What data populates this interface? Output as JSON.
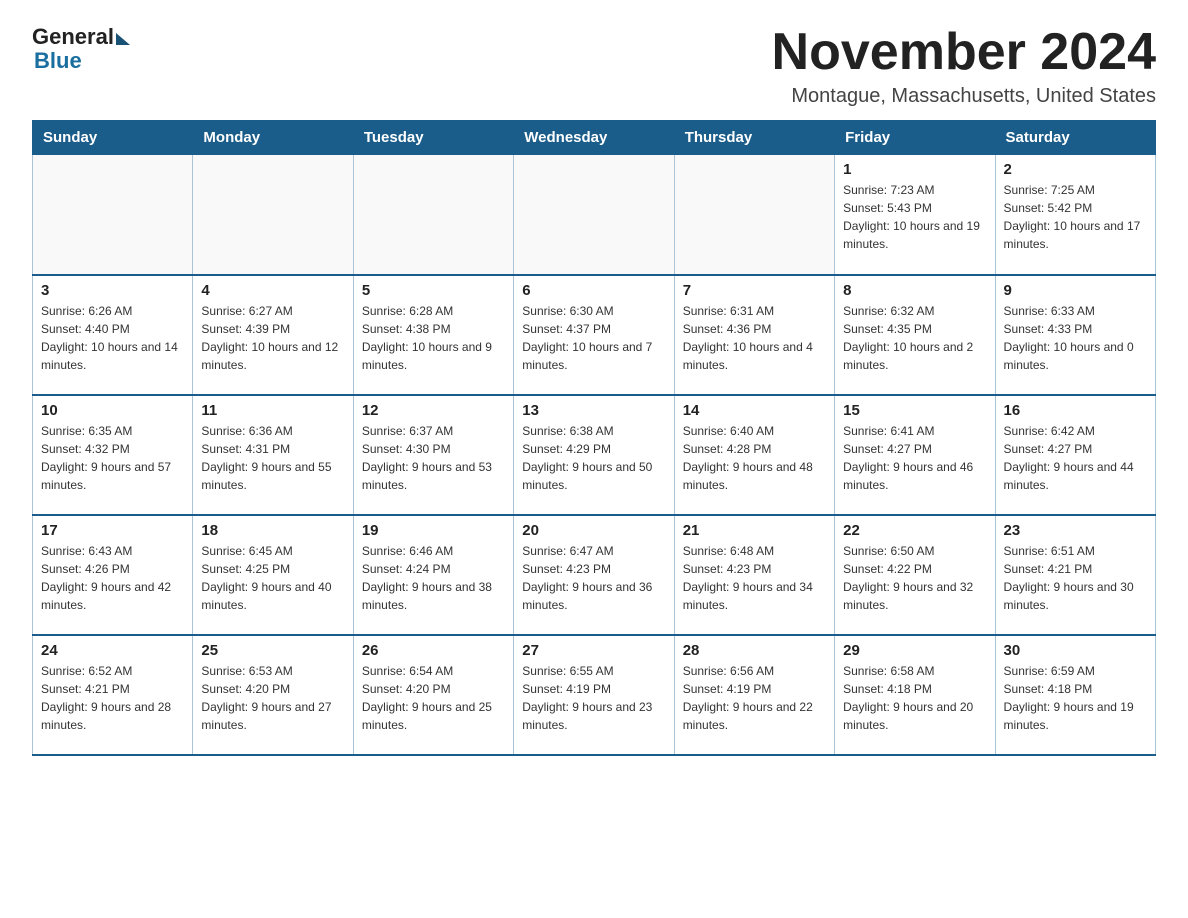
{
  "logo": {
    "general": "General",
    "blue": "Blue"
  },
  "header": {
    "month": "November 2024",
    "location": "Montague, Massachusetts, United States"
  },
  "days_of_week": [
    "Sunday",
    "Monday",
    "Tuesday",
    "Wednesday",
    "Thursday",
    "Friday",
    "Saturday"
  ],
  "weeks": [
    [
      {
        "day": "",
        "info": ""
      },
      {
        "day": "",
        "info": ""
      },
      {
        "day": "",
        "info": ""
      },
      {
        "day": "",
        "info": ""
      },
      {
        "day": "",
        "info": ""
      },
      {
        "day": "1",
        "info": "Sunrise: 7:23 AM\nSunset: 5:43 PM\nDaylight: 10 hours and 19 minutes."
      },
      {
        "day": "2",
        "info": "Sunrise: 7:25 AM\nSunset: 5:42 PM\nDaylight: 10 hours and 17 minutes."
      }
    ],
    [
      {
        "day": "3",
        "info": "Sunrise: 6:26 AM\nSunset: 4:40 PM\nDaylight: 10 hours and 14 minutes."
      },
      {
        "day": "4",
        "info": "Sunrise: 6:27 AM\nSunset: 4:39 PM\nDaylight: 10 hours and 12 minutes."
      },
      {
        "day": "5",
        "info": "Sunrise: 6:28 AM\nSunset: 4:38 PM\nDaylight: 10 hours and 9 minutes."
      },
      {
        "day": "6",
        "info": "Sunrise: 6:30 AM\nSunset: 4:37 PM\nDaylight: 10 hours and 7 minutes."
      },
      {
        "day": "7",
        "info": "Sunrise: 6:31 AM\nSunset: 4:36 PM\nDaylight: 10 hours and 4 minutes."
      },
      {
        "day": "8",
        "info": "Sunrise: 6:32 AM\nSunset: 4:35 PM\nDaylight: 10 hours and 2 minutes."
      },
      {
        "day": "9",
        "info": "Sunrise: 6:33 AM\nSunset: 4:33 PM\nDaylight: 10 hours and 0 minutes."
      }
    ],
    [
      {
        "day": "10",
        "info": "Sunrise: 6:35 AM\nSunset: 4:32 PM\nDaylight: 9 hours and 57 minutes."
      },
      {
        "day": "11",
        "info": "Sunrise: 6:36 AM\nSunset: 4:31 PM\nDaylight: 9 hours and 55 minutes."
      },
      {
        "day": "12",
        "info": "Sunrise: 6:37 AM\nSunset: 4:30 PM\nDaylight: 9 hours and 53 minutes."
      },
      {
        "day": "13",
        "info": "Sunrise: 6:38 AM\nSunset: 4:29 PM\nDaylight: 9 hours and 50 minutes."
      },
      {
        "day": "14",
        "info": "Sunrise: 6:40 AM\nSunset: 4:28 PM\nDaylight: 9 hours and 48 minutes."
      },
      {
        "day": "15",
        "info": "Sunrise: 6:41 AM\nSunset: 4:27 PM\nDaylight: 9 hours and 46 minutes."
      },
      {
        "day": "16",
        "info": "Sunrise: 6:42 AM\nSunset: 4:27 PM\nDaylight: 9 hours and 44 minutes."
      }
    ],
    [
      {
        "day": "17",
        "info": "Sunrise: 6:43 AM\nSunset: 4:26 PM\nDaylight: 9 hours and 42 minutes."
      },
      {
        "day": "18",
        "info": "Sunrise: 6:45 AM\nSunset: 4:25 PM\nDaylight: 9 hours and 40 minutes."
      },
      {
        "day": "19",
        "info": "Sunrise: 6:46 AM\nSunset: 4:24 PM\nDaylight: 9 hours and 38 minutes."
      },
      {
        "day": "20",
        "info": "Sunrise: 6:47 AM\nSunset: 4:23 PM\nDaylight: 9 hours and 36 minutes."
      },
      {
        "day": "21",
        "info": "Sunrise: 6:48 AM\nSunset: 4:23 PM\nDaylight: 9 hours and 34 minutes."
      },
      {
        "day": "22",
        "info": "Sunrise: 6:50 AM\nSunset: 4:22 PM\nDaylight: 9 hours and 32 minutes."
      },
      {
        "day": "23",
        "info": "Sunrise: 6:51 AM\nSunset: 4:21 PM\nDaylight: 9 hours and 30 minutes."
      }
    ],
    [
      {
        "day": "24",
        "info": "Sunrise: 6:52 AM\nSunset: 4:21 PM\nDaylight: 9 hours and 28 minutes."
      },
      {
        "day": "25",
        "info": "Sunrise: 6:53 AM\nSunset: 4:20 PM\nDaylight: 9 hours and 27 minutes."
      },
      {
        "day": "26",
        "info": "Sunrise: 6:54 AM\nSunset: 4:20 PM\nDaylight: 9 hours and 25 minutes."
      },
      {
        "day": "27",
        "info": "Sunrise: 6:55 AM\nSunset: 4:19 PM\nDaylight: 9 hours and 23 minutes."
      },
      {
        "day": "28",
        "info": "Sunrise: 6:56 AM\nSunset: 4:19 PM\nDaylight: 9 hours and 22 minutes."
      },
      {
        "day": "29",
        "info": "Sunrise: 6:58 AM\nSunset: 4:18 PM\nDaylight: 9 hours and 20 minutes."
      },
      {
        "day": "30",
        "info": "Sunrise: 6:59 AM\nSunset: 4:18 PM\nDaylight: 9 hours and 19 minutes."
      }
    ]
  ]
}
